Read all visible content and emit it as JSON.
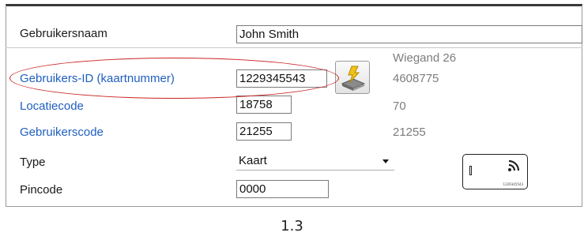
{
  "colors": {
    "link": "#1f5fbf",
    "annotation": "#cc2222",
    "readonly_text": "#7d7d7d"
  },
  "form": {
    "username": {
      "label": "Gebruikersnaam",
      "value": "John Smith"
    },
    "wiegand_header": "Wiegand 26",
    "user_id": {
      "label": "Gebruikers-ID (kaartnummer)",
      "value": "1229345543",
      "wiegand": "4608775",
      "button_icon": "encode-card-icon"
    },
    "location_code": {
      "label": "Locatiecode",
      "value": "18758",
      "wiegand": "70"
    },
    "user_code": {
      "label": "Gebruikerscode",
      "value": "21255",
      "wiegand": "21255"
    },
    "type": {
      "label": "Type",
      "value": "Kaart",
      "card_icon": "rfid-card-icon",
      "card_number": "1229345543"
    },
    "pincode": {
      "label": "Pincode",
      "value": "0000"
    }
  },
  "caption": "1.3"
}
